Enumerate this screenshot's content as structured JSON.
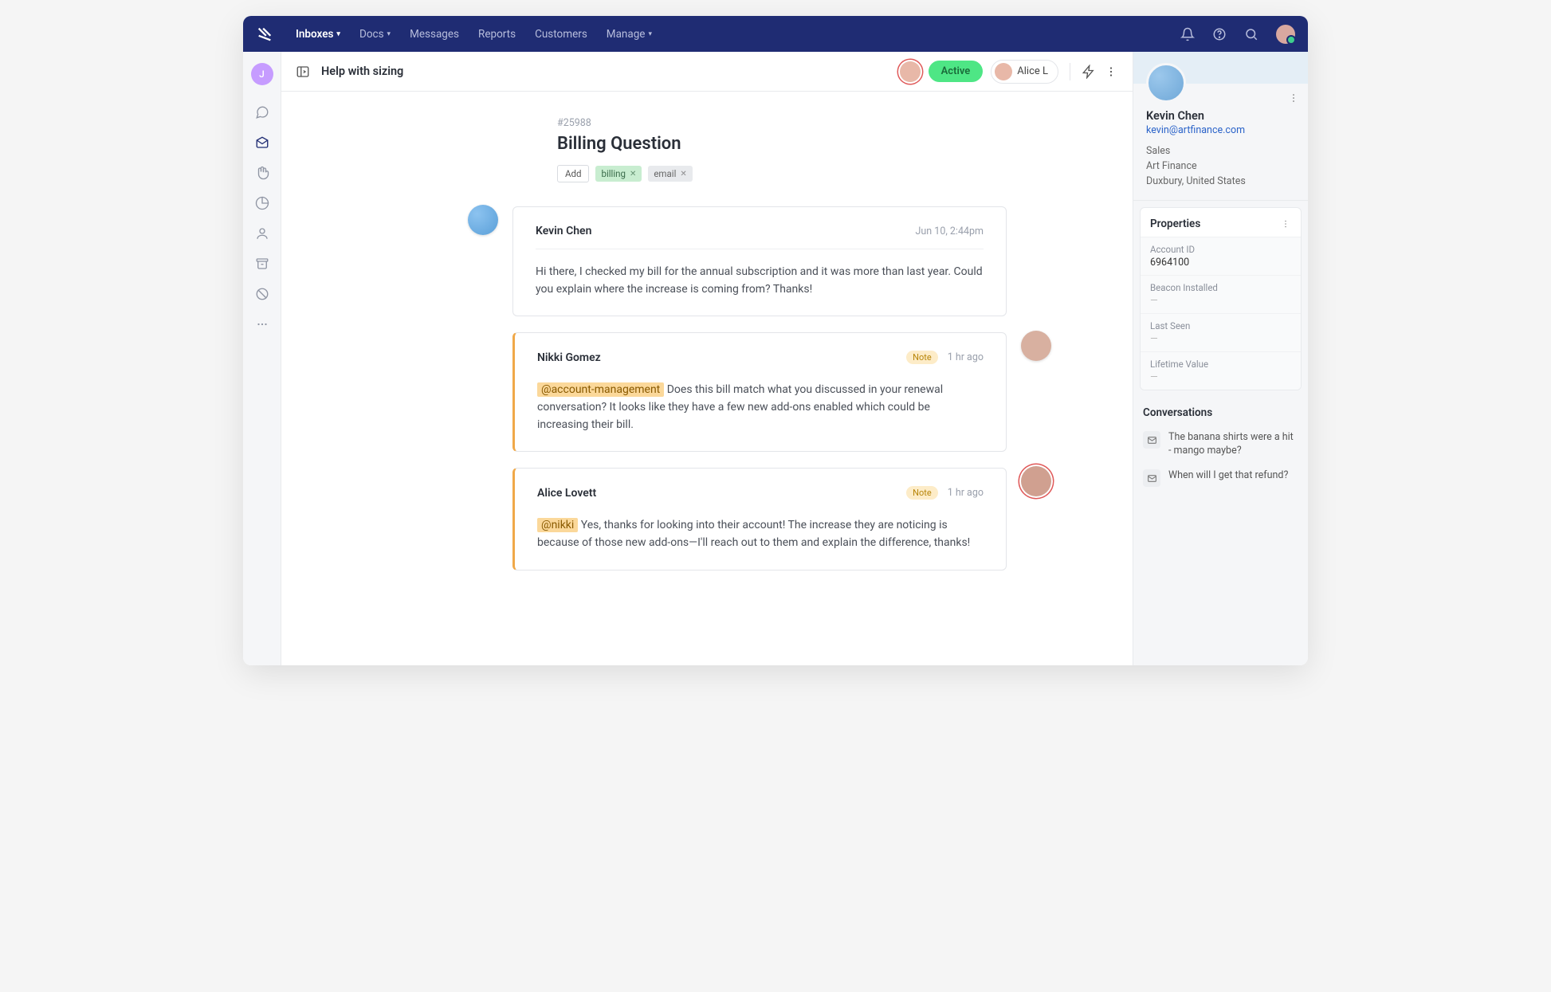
{
  "nav": {
    "items": [
      {
        "label": "Inboxes",
        "active": true,
        "caret": true
      },
      {
        "label": "Docs",
        "active": false,
        "caret": true
      },
      {
        "label": "Messages",
        "active": false,
        "caret": false
      },
      {
        "label": "Reports",
        "active": false,
        "caret": false
      },
      {
        "label": "Customers",
        "active": false,
        "caret": false
      },
      {
        "label": "Manage",
        "active": false,
        "caret": true
      }
    ]
  },
  "sideAvatarLetter": "J",
  "header": {
    "title": "Help with sizing",
    "status": "Active",
    "assignee": "Alice L"
  },
  "ticket": {
    "id": "#25988",
    "title": "Billing Question",
    "add_label": "Add",
    "tags": [
      {
        "label": "billing",
        "style": "green"
      },
      {
        "label": "email",
        "style": "gray"
      }
    ]
  },
  "messages": [
    {
      "author": "Kevin Chen",
      "time": "Jun 10, 2:44pm",
      "note": false,
      "avatar_side": "left",
      "body": "Hi there, I checked my bill for the annual subscription and it was more than last year. Could you explain where the increase is coming from? Thanks!"
    },
    {
      "author": "Nikki Gomez",
      "time": "1 hr ago",
      "note": true,
      "note_label": "Note",
      "avatar_side": "right",
      "mention": "@account-management",
      "body": " Does this bill match what you discussed in your renewal conversation? It looks like they have a few new add-ons enabled which could be increasing their bill."
    },
    {
      "author": "Alice Lovett",
      "time": "1 hr ago",
      "note": true,
      "note_label": "Note",
      "avatar_side": "right",
      "mention": "@nikki",
      "body": " Yes, thanks for looking into their account! The increase they are noticing is because of those new add-ons—I'll reach out to them and explain the difference, thanks!"
    }
  ],
  "customer": {
    "name": "Kevin Chen",
    "email": "kevin@artfinance.com",
    "role": "Sales",
    "company": "Art Finance",
    "location": "Duxbury, United States"
  },
  "properties": {
    "title": "Properties",
    "items": [
      {
        "label": "Account ID",
        "value": "6964100"
      },
      {
        "label": "Beacon Installed",
        "value": "—"
      },
      {
        "label": "Last Seen",
        "value": "—"
      },
      {
        "label": "Lifetime Value",
        "value": "—"
      }
    ]
  },
  "conversations": {
    "title": "Conversations",
    "items": [
      {
        "text": "The banana shirts were a hit - mango maybe?"
      },
      {
        "text": "When will I get that refund?"
      }
    ]
  }
}
